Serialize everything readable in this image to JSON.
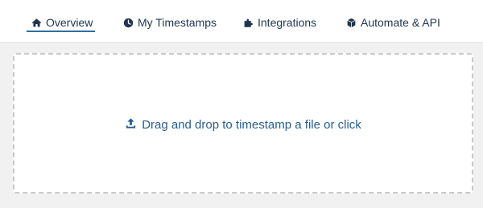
{
  "nav": {
    "tabs": [
      {
        "label": "Overview",
        "icon": "home-icon",
        "active": true
      },
      {
        "label": "My Timestamps",
        "icon": "clock-icon",
        "active": false
      },
      {
        "label": "Integrations",
        "icon": "puzzle-icon",
        "active": false
      },
      {
        "label": "Automate & API",
        "icon": "cube-icon",
        "active": false
      }
    ]
  },
  "dropzone": {
    "text": "Drag and drop to timestamp a file or click",
    "icon": "upload-icon"
  },
  "colors": {
    "nav_text": "#1f3550",
    "accent": "#2f6f9f",
    "drop_text": "#2a5d8c",
    "background": "#f1f1f1",
    "dashed_border": "#c9c9c9"
  }
}
